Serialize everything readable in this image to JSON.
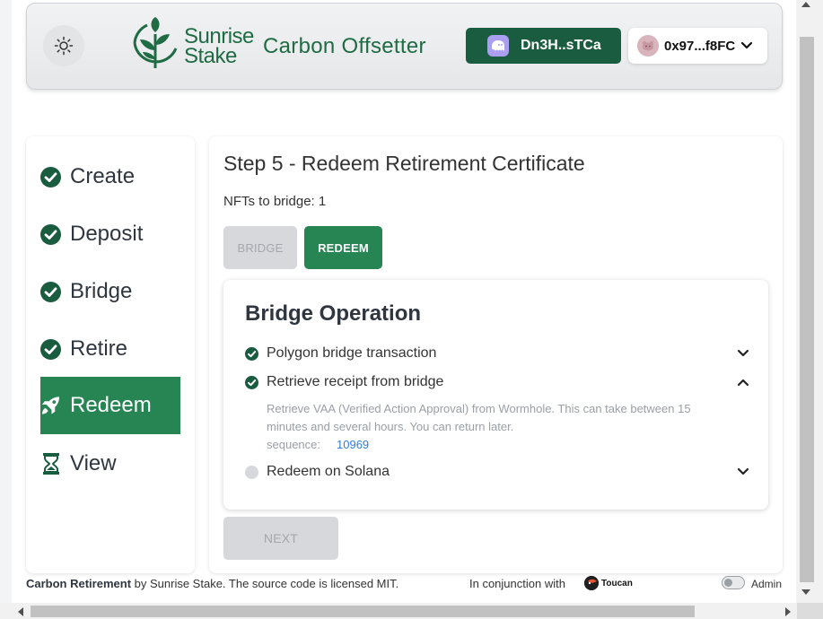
{
  "header": {
    "logo_line1": "Sunrise",
    "logo_line2": "Stake",
    "app_title": "Carbon Offsetter",
    "sol_wallet": "Dn3H..sTCa",
    "eth_wallet": "0x97...f8FC"
  },
  "sidebar": {
    "steps": [
      {
        "label": "Create",
        "icon": "check-circle-icon",
        "status": "done"
      },
      {
        "label": "Deposit",
        "icon": "check-circle-icon",
        "status": "done"
      },
      {
        "label": "Bridge",
        "icon": "check-circle-icon",
        "status": "done"
      },
      {
        "label": "Retire",
        "icon": "check-circle-icon",
        "status": "done"
      },
      {
        "label": "Redeem",
        "icon": "rocket-icon",
        "status": "active"
      },
      {
        "label": "View",
        "icon": "hourglass-icon",
        "status": "pending"
      }
    ]
  },
  "main": {
    "title": "Step 5 - Redeem Retirement Certificate",
    "nfts_label": "NFTs to bridge: 1",
    "bridge_button": "BRIDGE",
    "redeem_button": "REDEEM",
    "next_button": "NEXT",
    "operation": {
      "title": "Bridge Operation",
      "steps": [
        {
          "label": "Polygon bridge transaction",
          "status": "done",
          "expanded": false
        },
        {
          "label": "Retrieve receipt from bridge",
          "status": "done",
          "expanded": true
        },
        {
          "label": "Redeem on Solana",
          "status": "pending",
          "expanded": false
        }
      ],
      "detail_text": "Retrieve VAA (Verified Action Approval) from Wormhole. This can take between 15 minutes and several hours. You can return later.",
      "sequence_label": "sequence:",
      "sequence_value": "10969"
    }
  },
  "footer": {
    "brand": "Carbon Retirement",
    "license_text": " by Sunrise Stake. The source code is licensed MIT.",
    "conjunction": "In conjunction with",
    "partner": "Toucan",
    "admin_label": "Admin",
    "admin_enabled": false
  },
  "colors": {
    "brand_green": "#1f6b44",
    "active_green": "#268553",
    "wallet_green": "#1a5c3f",
    "link_blue": "#2f7ed8"
  }
}
